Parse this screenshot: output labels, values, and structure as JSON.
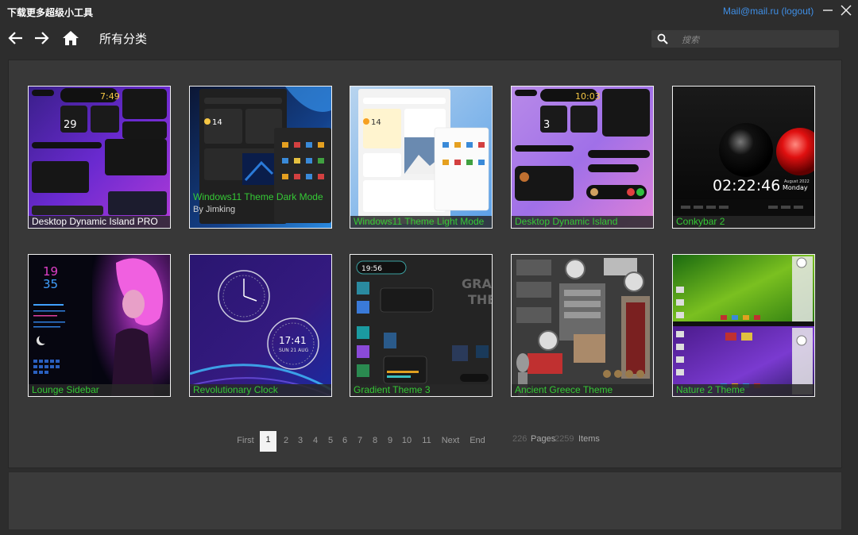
{
  "app": {
    "title": "下载更多超级小工具",
    "account": "Mail@mail.ru (logout)"
  },
  "nav": {
    "breadcrumb": "所有分类",
    "search_placeholder": "搜索"
  },
  "tiles": [
    {
      "title": "Desktop Dynamic Island PRO",
      "byline": "",
      "caption_color": "#ffffff"
    },
    {
      "title": "Windows11 Theme Dark Mode",
      "byline": "By Jimking",
      "caption_color": "#35c935"
    },
    {
      "title": "Windows11 Theme Light Mode",
      "byline": "",
      "caption_color": "#35c935"
    },
    {
      "title": "Desktop Dynamic Island",
      "byline": "",
      "caption_color": "#35c935"
    },
    {
      "title": "Conkybar 2",
      "byline": "",
      "caption_color": "#35c935"
    },
    {
      "title": "Lounge Sidebar",
      "byline": "",
      "caption_color": "#35c935"
    },
    {
      "title": "Revolutionary Clock",
      "byline": "",
      "caption_color": "#35c935"
    },
    {
      "title": "Gradient Theme 3",
      "byline": "",
      "caption_color": "#35c935"
    },
    {
      "title": "Ancient Greece Theme",
      "byline": "",
      "caption_color": "#35c935"
    },
    {
      "title": "Nature 2 Theme",
      "byline": "",
      "caption_color": "#35c935"
    }
  ],
  "tile_text": {
    "t1_clock": "7:49",
    "t1_day": "29",
    "t2_temp": "14",
    "t3_temp": "14",
    "t4_clock": "10:03",
    "t4_day": "3",
    "t5_clock": "02:22:46",
    "t5_date": "August 2022",
    "t5_day": "Monday",
    "t6_hour": "19",
    "t6_min": "35",
    "t7_clock": "17:41",
    "t7_date": "SUN 21 AUG",
    "t8_clock": "19:56",
    "t8_big": "GRAD",
    "t8_big2": "THE"
  },
  "pagination": {
    "first": "First",
    "pages": [
      "1",
      "2",
      "3",
      "4",
      "5",
      "6",
      "7",
      "8",
      "9",
      "10",
      "11"
    ],
    "current": "1",
    "next": "Next",
    "end": "End",
    "total_pages": "226",
    "pages_label": "Pages",
    "total_items": "2259",
    "items_label": "Items"
  },
  "colors": {
    "caption_green": "#35c935",
    "link_blue": "#3f8fe6"
  }
}
